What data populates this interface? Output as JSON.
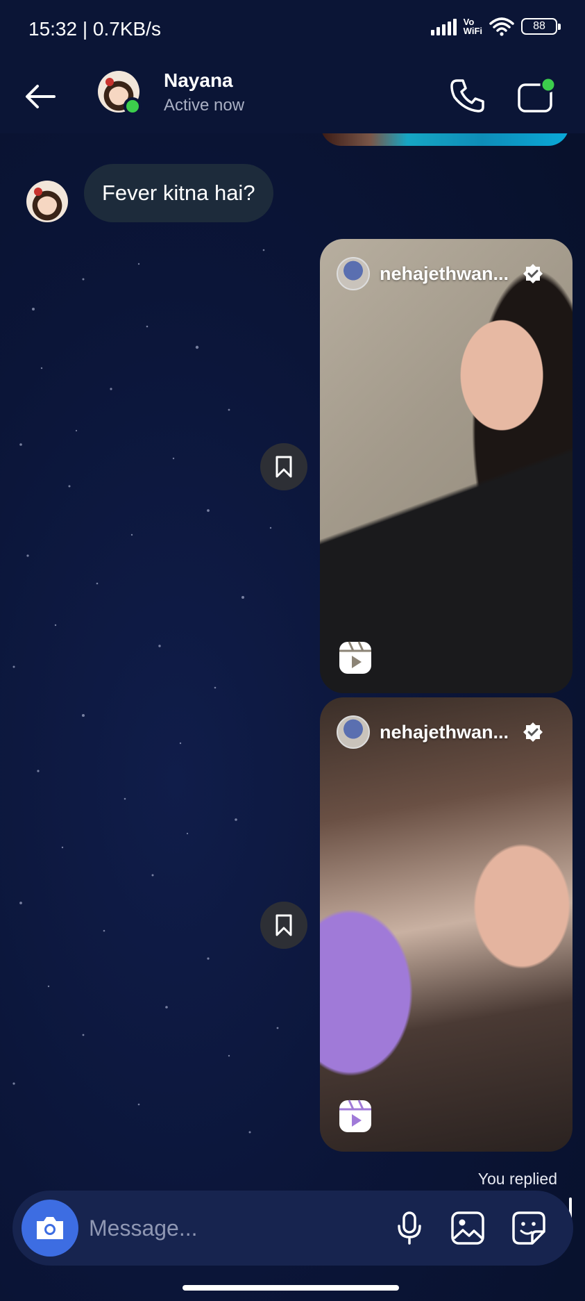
{
  "status_bar": {
    "time_speed": "15:32 | 0.7KB/s",
    "vowifi_top": "Vo",
    "vowifi_bottom": "WiFi",
    "battery": "88"
  },
  "header": {
    "contact_name": "Nayana",
    "contact_status": "Active now",
    "online_color": "#3ccd4c"
  },
  "messages": [
    {
      "type": "text",
      "direction": "incoming",
      "text": "Fever kitna hai?"
    },
    {
      "type": "reel",
      "direction": "outgoing",
      "username": "nehajethwan...",
      "verified": true
    },
    {
      "type": "reel",
      "direction": "outgoing",
      "username": "nehajethwan...",
      "verified": true
    }
  ],
  "reply_note": "You replied",
  "composer": {
    "placeholder": "Message...",
    "accent_color": "#3d6de2",
    "icons": [
      "camera-icon",
      "microphone-icon",
      "gallery-icon",
      "sticker-icon"
    ]
  }
}
